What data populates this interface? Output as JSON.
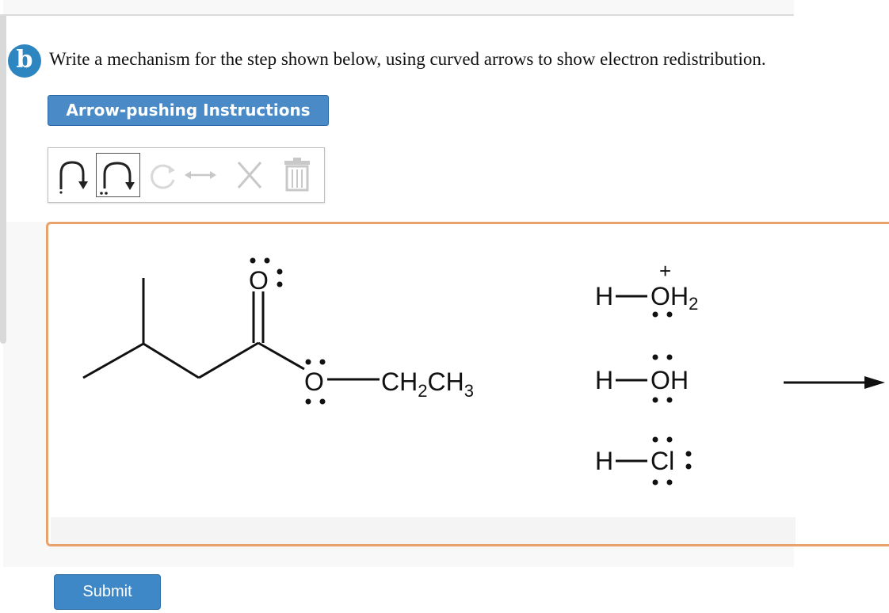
{
  "question": {
    "part_label": "b",
    "text": "Write a mechanism for the step shown below, using curved arrows to show electron redistribution."
  },
  "instructions_button": {
    "label": "Arrow-pushing Instructions"
  },
  "toolbar": {
    "tools": [
      {
        "icon": "single-curved-arrow-icon"
      },
      {
        "icon": "lone-pair-curved-arrow-icon",
        "selected": true
      },
      {
        "icon": "rotate-icon",
        "disabled": true
      },
      {
        "icon": "resonance-arrow-icon",
        "disabled": true
      },
      {
        "icon": "delete-x-icon",
        "disabled": true
      },
      {
        "icon": "trash-icon",
        "disabled": true
      }
    ]
  },
  "molecules": {
    "ester": {
      "carbonyl_o": "O",
      "ether_o": "O",
      "ethyl_group": "CH",
      "sub1": "2",
      "ch": "CH",
      "sub2": "3"
    },
    "hydronium": {
      "h": "H",
      "o": "O",
      "h2": "H",
      "sub": "2",
      "charge": "+"
    },
    "water": {
      "h": "H",
      "o": "O",
      "h2": "H"
    },
    "hcl": {
      "h": "H",
      "cl": "Cl"
    }
  },
  "submit_button": {
    "label": "Submit"
  },
  "colors": {
    "accent": "#4a8ac7",
    "badge": "#2e86c1",
    "canvas_border": "#e9a26c"
  }
}
